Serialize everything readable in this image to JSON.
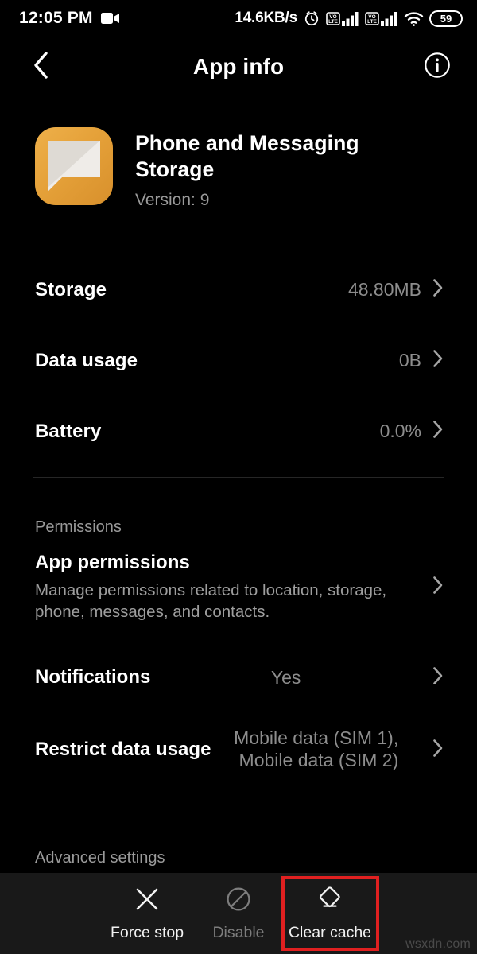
{
  "status_bar": {
    "time": "12:05 PM",
    "recording_icon": "video-camera-icon",
    "network_speed": "14.6KB/s",
    "alarm_icon": "alarm-clock-icon",
    "sim1_badge": "VoLTE",
    "sim2_badge": "VoLTE",
    "wifi_icon": "wifi-icon",
    "battery_level": "59"
  },
  "app_bar": {
    "back_icon": "chevron-left-icon",
    "title": "App info",
    "info_icon": "info-circle-icon"
  },
  "app_header": {
    "icon": "messaging-storage-app-icon",
    "icon_color": "#e5a139",
    "name": "Phone and Messaging Storage",
    "version": "Version: 9"
  },
  "info_rows": [
    {
      "label": "Storage",
      "value": "48.80MB"
    },
    {
      "label": "Data usage",
      "value": "0B"
    },
    {
      "label": "Battery",
      "value": "0.0%"
    }
  ],
  "permissions_section": {
    "header": "Permissions",
    "app_permissions": {
      "title": "App permissions",
      "subtitle": "Manage permissions related to location, storage, phone, messages, and contacts."
    },
    "notifications": {
      "label": "Notifications",
      "value": "Yes"
    },
    "restrict_data": {
      "label": "Restrict data usage",
      "value": "Mobile data (SIM 1),\nMobile data (SIM 2)"
    }
  },
  "advanced_section": {
    "header": "Advanced settings"
  },
  "bottom_bar": {
    "force_stop": {
      "label": "Force stop",
      "icon": "close-x-icon",
      "enabled": true
    },
    "disable": {
      "label": "Disable",
      "icon": "block-circle-icon",
      "enabled": false
    },
    "clear_cache": {
      "label": "Clear cache",
      "icon": "eraser-icon",
      "enabled": true,
      "highlight_color": "#e02020"
    }
  },
  "watermark": "wsxdn.com"
}
